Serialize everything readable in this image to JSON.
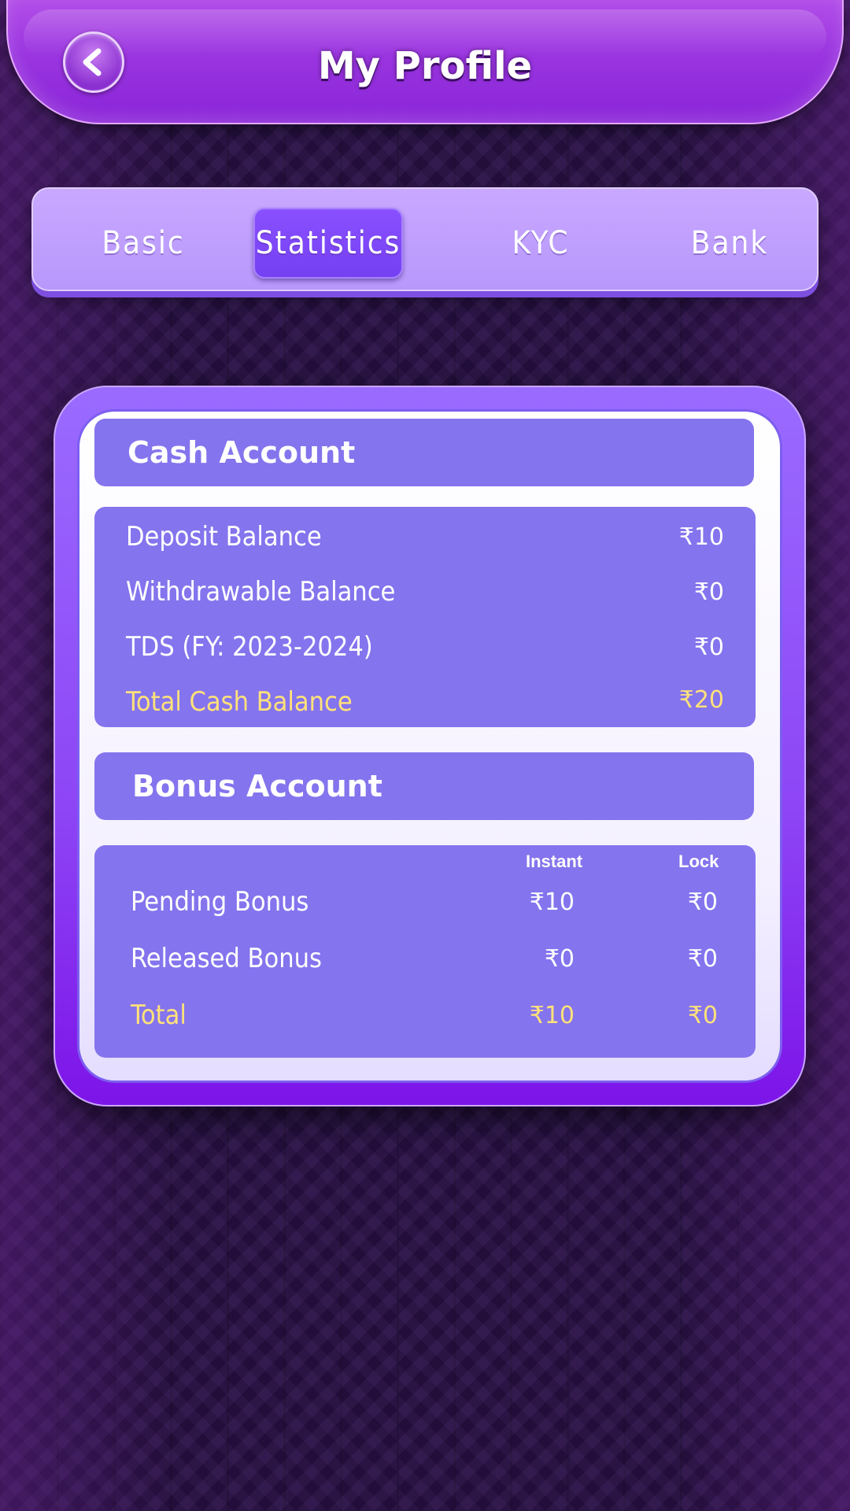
{
  "header": {
    "title": "My Profile",
    "back_icon": "chevron-left-icon"
  },
  "tabs": [
    {
      "label": "Basic",
      "active": false
    },
    {
      "label": "Statistics",
      "active": true
    },
    {
      "label": "KYC",
      "active": false
    },
    {
      "label": "Bank",
      "active": false
    }
  ],
  "cash_account": {
    "title": "Cash Account",
    "rows": [
      {
        "label": "Deposit Balance",
        "value": "₹10"
      },
      {
        "label": "Withdrawable Balance",
        "value": "₹0"
      },
      {
        "label": "TDS (FY: 2023-2024)",
        "value": "₹0"
      },
      {
        "label": "Total Cash Balance",
        "value": "₹20"
      }
    ]
  },
  "bonus_account": {
    "title": "Bonus Account",
    "columns": [
      "Instant",
      "Lock"
    ],
    "rows": [
      {
        "label": "Pending Bonus",
        "instant": "₹10",
        "lock": "₹0"
      },
      {
        "label": "Released Bonus",
        "instant": "₹0",
        "lock": "₹0"
      },
      {
        "label": "Total",
        "instant": "₹10",
        "lock": "₹0"
      }
    ]
  },
  "colors": {
    "section_bg": "#8474ed",
    "highlight_text": "#ffe17a",
    "header_purple": "#9a35e0"
  }
}
